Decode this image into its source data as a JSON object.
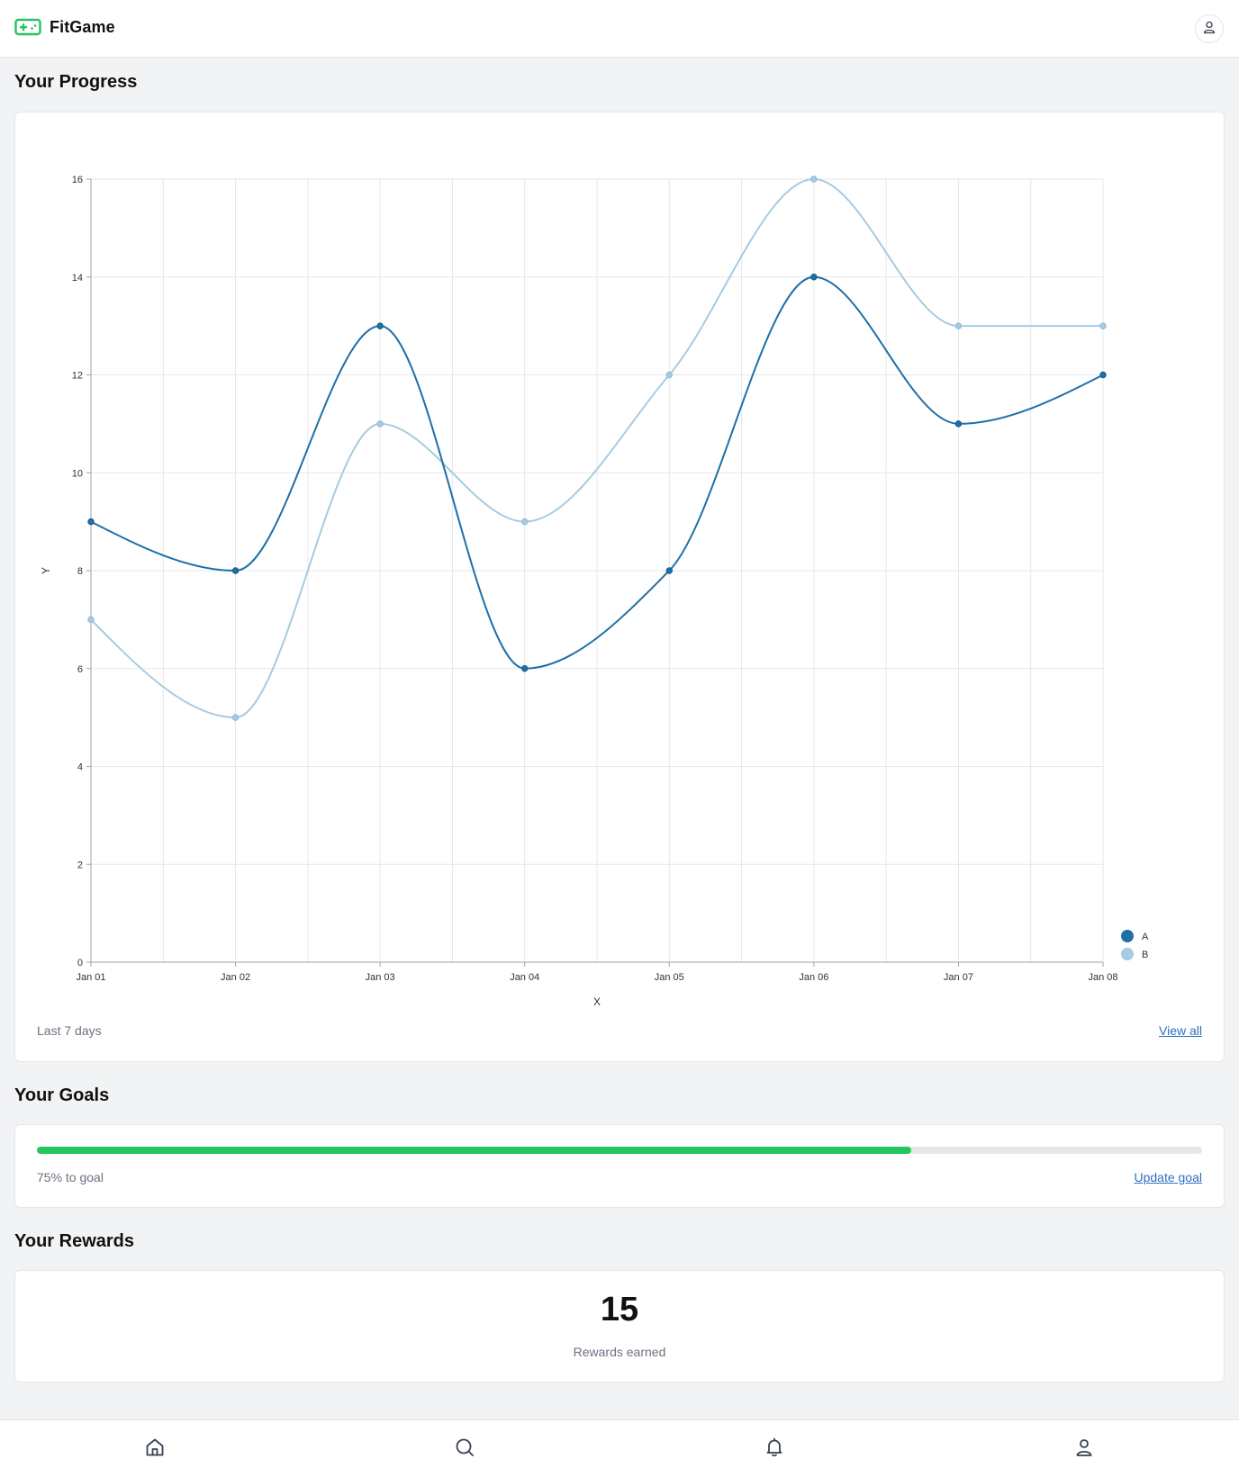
{
  "header": {
    "app_name": "FitGame",
    "logo_icon": "gamepad-icon",
    "profile_icon": "user-icon"
  },
  "progress": {
    "title": "Your Progress",
    "footer_text": "Last 7 days",
    "link_label": "View all"
  },
  "chart_data": {
    "type": "line",
    "x": [
      "Jan 01",
      "Jan 02",
      "Jan 03",
      "Jan 04",
      "Jan 05",
      "Jan 06",
      "Jan 07",
      "Jan 08"
    ],
    "series": [
      {
        "name": "A",
        "values": [
          9,
          8,
          13,
          6,
          8,
          14,
          11,
          12
        ],
        "color": "#1f6fa8"
      },
      {
        "name": "B",
        "values": [
          7,
          5,
          11,
          9,
          12,
          16,
          13,
          13
        ],
        "color": "#a6cbe2"
      }
    ],
    "xlabel": "X",
    "ylabel": "Y",
    "ylim": [
      0,
      16
    ],
    "yticks": [
      0,
      2,
      4,
      6,
      8,
      10,
      12,
      14,
      16
    ],
    "grid": true,
    "curve": "smooth",
    "legend_position": "bottom-right"
  },
  "goals": {
    "title": "Your Goals",
    "progress_fraction": 0.75,
    "progress_text": "75% to goal",
    "link_label": "Update goal",
    "bar_color": "#22c55e"
  },
  "rewards": {
    "title": "Your Rewards",
    "count": "15",
    "label": "Rewards earned"
  },
  "bottom_nav": {
    "items": [
      {
        "icon": "home-icon"
      },
      {
        "icon": "search-icon"
      },
      {
        "icon": "bell-icon"
      },
      {
        "icon": "user-icon"
      }
    ]
  }
}
